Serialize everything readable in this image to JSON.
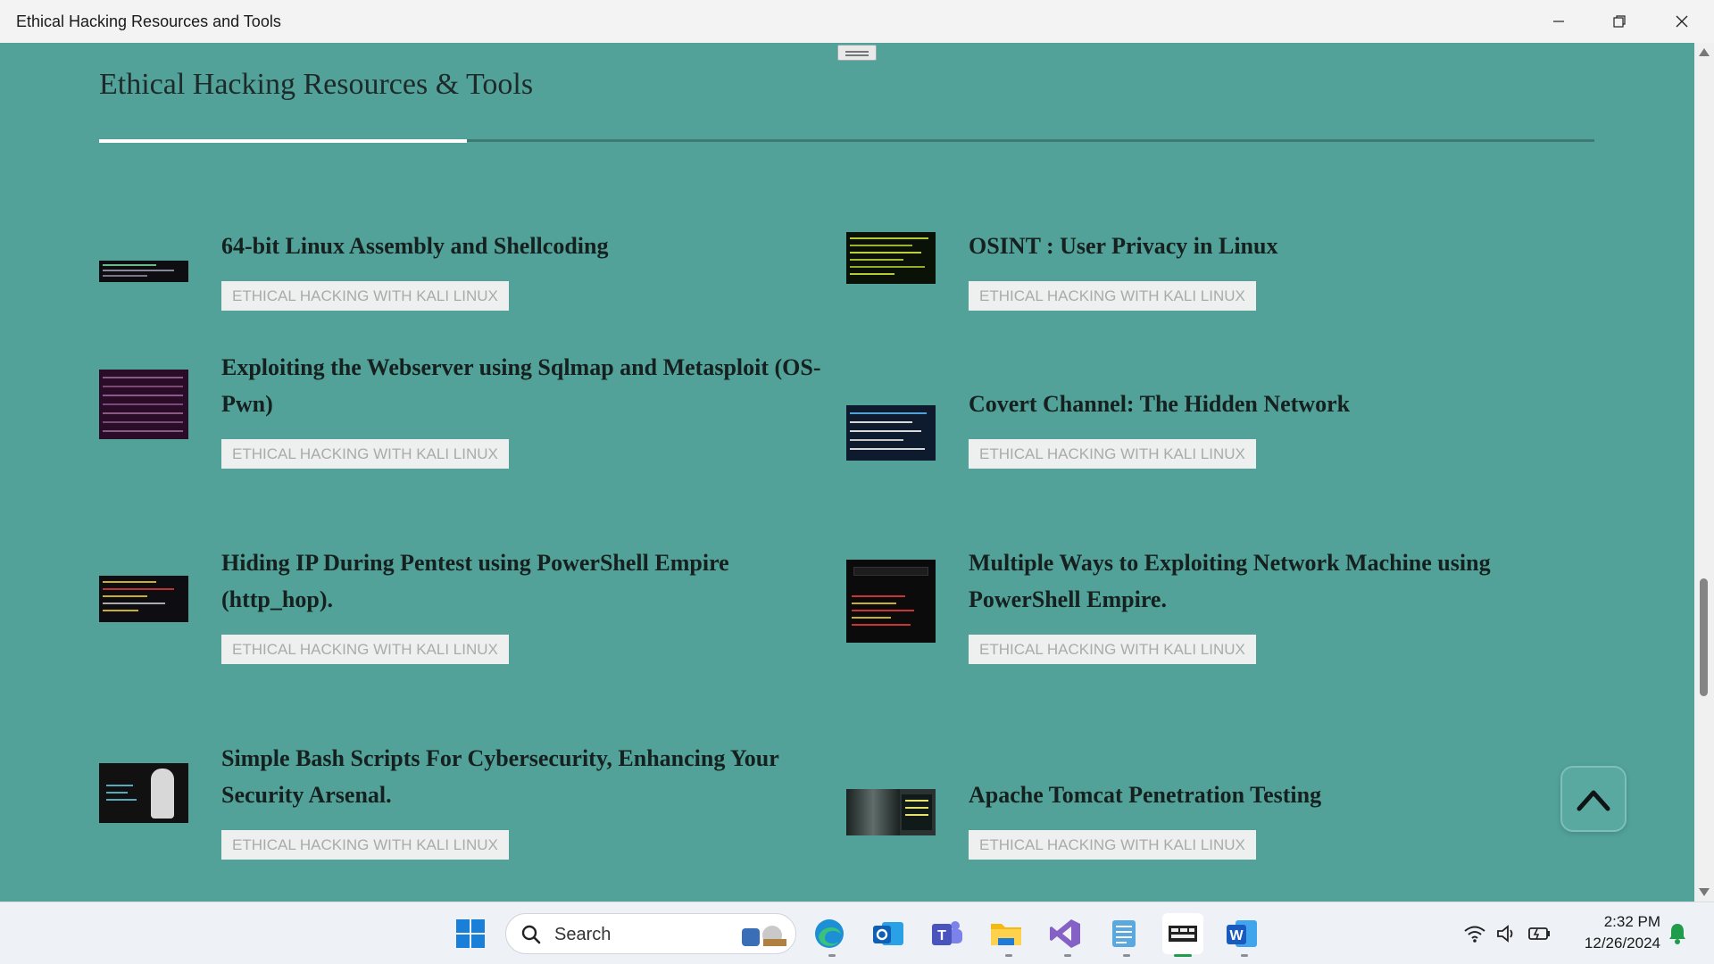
{
  "window": {
    "title": "Ethical Hacking Resources and Tools",
    "controls": [
      "minimize",
      "restore",
      "close"
    ]
  },
  "page": {
    "heading": "Ethical Hacking Resources & Tools",
    "articles": [
      {
        "title": "64-bit Linux Assembly and Shellcoding",
        "tag": "ETHICAL HACKING WITH KALI LINUX",
        "thumb": "terminal-icon"
      },
      {
        "title": "OSINT : User Privacy in Linux",
        "tag": "ETHICAL HACKING WITH KALI LINUX",
        "thumb": "terminal-icon"
      },
      {
        "title": "Exploiting the Webserver using Sqlmap and Metasploit (OS-Pwn)",
        "tag": "ETHICAL HACKING WITH KALI LINUX",
        "thumb": "terminal-icon"
      },
      {
        "title": "Covert Channel: The Hidden Network",
        "tag": "ETHICAL HACKING WITH KALI LINUX",
        "thumb": "terminal-icon"
      },
      {
        "title": "Hiding IP During Pentest using PowerShell Empire (http_hop).",
        "tag": "ETHICAL HACKING WITH KALI LINUX",
        "thumb": "terminal-icon"
      },
      {
        "title": "Multiple Ways to Exploiting Network Machine using PowerShell Empire.",
        "tag": "ETHICAL HACKING WITH KALI LINUX",
        "thumb": "terminal-icon"
      },
      {
        "title": "Simple Bash Scripts For Cybersecurity, Enhancing Your Security Arsenal.",
        "tag": "ETHICAL HACKING WITH KALI LINUX",
        "thumb": "hacker-icon"
      },
      {
        "title": "Apache Tomcat Penetration Testing",
        "tag": "ETHICAL HACKING WITH KALI LINUX",
        "thumb": "server-room-icon"
      }
    ],
    "scroll_top_icon": "chevron-up-icon"
  },
  "taskbar": {
    "search_label": "Search",
    "apps": [
      "windows-start-icon",
      "edge-icon",
      "outlook-icon",
      "teams-icon",
      "file-explorer-icon",
      "visual-studio-icon",
      "notepad-icon",
      "terminal-app-icon",
      "word-icon"
    ],
    "tray": [
      "wifi-icon",
      "volume-icon",
      "battery-icon"
    ],
    "time": "2:32 PM",
    "date": "12/26/2024"
  },
  "colors": {
    "background": "#52a29a",
    "tag_bg": "#eef0ef",
    "tag_text": "#a7abaa",
    "accent": "#ffffff"
  }
}
